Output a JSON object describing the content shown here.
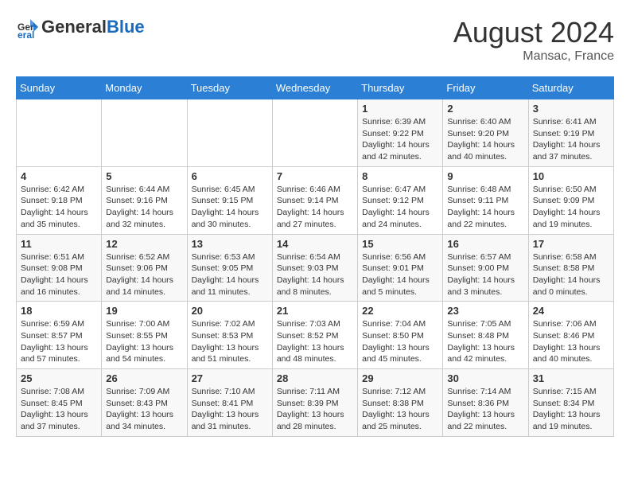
{
  "header": {
    "logo_general": "General",
    "logo_blue": "Blue",
    "month_year": "August 2024",
    "location": "Mansac, France"
  },
  "days_of_week": [
    "Sunday",
    "Monday",
    "Tuesday",
    "Wednesday",
    "Thursday",
    "Friday",
    "Saturday"
  ],
  "weeks": [
    [
      {
        "day": "",
        "info": ""
      },
      {
        "day": "",
        "info": ""
      },
      {
        "day": "",
        "info": ""
      },
      {
        "day": "",
        "info": ""
      },
      {
        "day": "1",
        "info": "Sunrise: 6:39 AM\nSunset: 9:22 PM\nDaylight: 14 hours\nand 42 minutes."
      },
      {
        "day": "2",
        "info": "Sunrise: 6:40 AM\nSunset: 9:20 PM\nDaylight: 14 hours\nand 40 minutes."
      },
      {
        "day": "3",
        "info": "Sunrise: 6:41 AM\nSunset: 9:19 PM\nDaylight: 14 hours\nand 37 minutes."
      }
    ],
    [
      {
        "day": "4",
        "info": "Sunrise: 6:42 AM\nSunset: 9:18 PM\nDaylight: 14 hours\nand 35 minutes."
      },
      {
        "day": "5",
        "info": "Sunrise: 6:44 AM\nSunset: 9:16 PM\nDaylight: 14 hours\nand 32 minutes."
      },
      {
        "day": "6",
        "info": "Sunrise: 6:45 AM\nSunset: 9:15 PM\nDaylight: 14 hours\nand 30 minutes."
      },
      {
        "day": "7",
        "info": "Sunrise: 6:46 AM\nSunset: 9:14 PM\nDaylight: 14 hours\nand 27 minutes."
      },
      {
        "day": "8",
        "info": "Sunrise: 6:47 AM\nSunset: 9:12 PM\nDaylight: 14 hours\nand 24 minutes."
      },
      {
        "day": "9",
        "info": "Sunrise: 6:48 AM\nSunset: 9:11 PM\nDaylight: 14 hours\nand 22 minutes."
      },
      {
        "day": "10",
        "info": "Sunrise: 6:50 AM\nSunset: 9:09 PM\nDaylight: 14 hours\nand 19 minutes."
      }
    ],
    [
      {
        "day": "11",
        "info": "Sunrise: 6:51 AM\nSunset: 9:08 PM\nDaylight: 14 hours\nand 16 minutes."
      },
      {
        "day": "12",
        "info": "Sunrise: 6:52 AM\nSunset: 9:06 PM\nDaylight: 14 hours\nand 14 minutes."
      },
      {
        "day": "13",
        "info": "Sunrise: 6:53 AM\nSunset: 9:05 PM\nDaylight: 14 hours\nand 11 minutes."
      },
      {
        "day": "14",
        "info": "Sunrise: 6:54 AM\nSunset: 9:03 PM\nDaylight: 14 hours\nand 8 minutes."
      },
      {
        "day": "15",
        "info": "Sunrise: 6:56 AM\nSunset: 9:01 PM\nDaylight: 14 hours\nand 5 minutes."
      },
      {
        "day": "16",
        "info": "Sunrise: 6:57 AM\nSunset: 9:00 PM\nDaylight: 14 hours\nand 3 minutes."
      },
      {
        "day": "17",
        "info": "Sunrise: 6:58 AM\nSunset: 8:58 PM\nDaylight: 14 hours\nand 0 minutes."
      }
    ],
    [
      {
        "day": "18",
        "info": "Sunrise: 6:59 AM\nSunset: 8:57 PM\nDaylight: 13 hours\nand 57 minutes."
      },
      {
        "day": "19",
        "info": "Sunrise: 7:00 AM\nSunset: 8:55 PM\nDaylight: 13 hours\nand 54 minutes."
      },
      {
        "day": "20",
        "info": "Sunrise: 7:02 AM\nSunset: 8:53 PM\nDaylight: 13 hours\nand 51 minutes."
      },
      {
        "day": "21",
        "info": "Sunrise: 7:03 AM\nSunset: 8:52 PM\nDaylight: 13 hours\nand 48 minutes."
      },
      {
        "day": "22",
        "info": "Sunrise: 7:04 AM\nSunset: 8:50 PM\nDaylight: 13 hours\nand 45 minutes."
      },
      {
        "day": "23",
        "info": "Sunrise: 7:05 AM\nSunset: 8:48 PM\nDaylight: 13 hours\nand 42 minutes."
      },
      {
        "day": "24",
        "info": "Sunrise: 7:06 AM\nSunset: 8:46 PM\nDaylight: 13 hours\nand 40 minutes."
      }
    ],
    [
      {
        "day": "25",
        "info": "Sunrise: 7:08 AM\nSunset: 8:45 PM\nDaylight: 13 hours\nand 37 minutes."
      },
      {
        "day": "26",
        "info": "Sunrise: 7:09 AM\nSunset: 8:43 PM\nDaylight: 13 hours\nand 34 minutes."
      },
      {
        "day": "27",
        "info": "Sunrise: 7:10 AM\nSunset: 8:41 PM\nDaylight: 13 hours\nand 31 minutes."
      },
      {
        "day": "28",
        "info": "Sunrise: 7:11 AM\nSunset: 8:39 PM\nDaylight: 13 hours\nand 28 minutes."
      },
      {
        "day": "29",
        "info": "Sunrise: 7:12 AM\nSunset: 8:38 PM\nDaylight: 13 hours\nand 25 minutes."
      },
      {
        "day": "30",
        "info": "Sunrise: 7:14 AM\nSunset: 8:36 PM\nDaylight: 13 hours\nand 22 minutes."
      },
      {
        "day": "31",
        "info": "Sunrise: 7:15 AM\nSunset: 8:34 PM\nDaylight: 13 hours\nand 19 minutes."
      }
    ]
  ]
}
